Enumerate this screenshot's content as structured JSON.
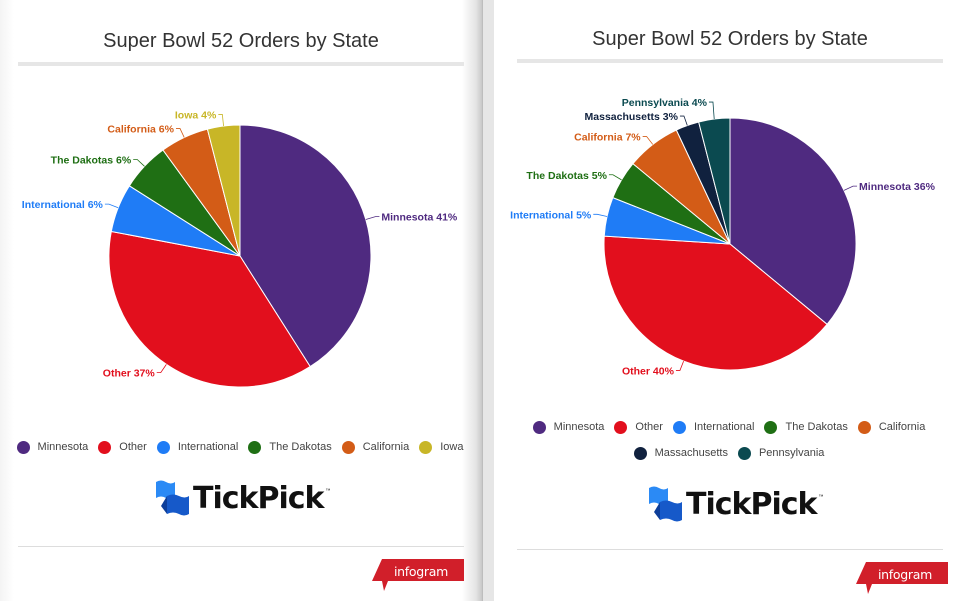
{
  "chart_data": [
    {
      "type": "pie",
      "title": "Super Bowl 52 Orders by State",
      "categories": [
        "Minnesota",
        "Other",
        "International",
        "The Dakotas",
        "California",
        "Iowa"
      ],
      "values": [
        41,
        37,
        6,
        6,
        6,
        4
      ],
      "labels": [
        "Minnesota 41%",
        "Other 37%",
        "International 6%",
        "The Dakotas 6%",
        "California 6%",
        "Iowa 4%"
      ],
      "colors": [
        "#4f2a80",
        "#e20f1d",
        "#1f7cf6",
        "#1f6f14",
        "#d35c17",
        "#c8b627"
      ],
      "unit": "%",
      "legend_position": "bottom"
    },
    {
      "type": "pie",
      "title": "Super Bowl 52 Orders by State",
      "categories": [
        "Minnesota",
        "Other",
        "International",
        "The Dakotas",
        "California",
        "Massachusetts",
        "Pennsylvania"
      ],
      "values": [
        36,
        40,
        5,
        5,
        7,
        3,
        4
      ],
      "labels": [
        "Minnesota 36%",
        "Other 40%",
        "International 5%",
        "The Dakotas 5%",
        "California 7%",
        "Massachusetts 3%",
        "Pennsylvania 4%"
      ],
      "colors": [
        "#4f2a80",
        "#e20f1d",
        "#1f7cf6",
        "#1f6f14",
        "#d35c17",
        "#10213e",
        "#0b4a50"
      ],
      "unit": "%",
      "legend_position": "bottom"
    }
  ],
  "branding": {
    "logo_text": "TickPick",
    "logo_tm": "™",
    "infogram_label": "infogram"
  }
}
